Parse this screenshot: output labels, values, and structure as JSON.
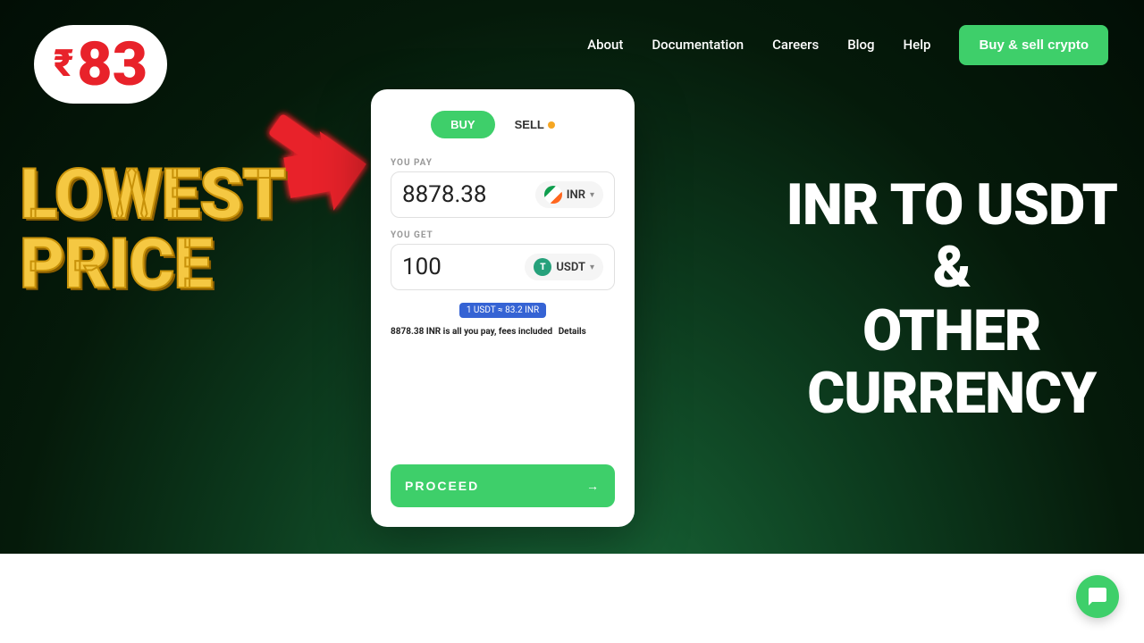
{
  "nav": {
    "links": [
      {
        "label": "About",
        "id": "about"
      },
      {
        "label": "Documentation",
        "id": "documentation"
      },
      {
        "label": "Careers",
        "id": "careers"
      },
      {
        "label": "Blog",
        "id": "blog"
      },
      {
        "label": "Help",
        "id": "help"
      }
    ],
    "cta_label": "Buy & sell crypto"
  },
  "hero": {
    "price_badge": {
      "rupee": "₹",
      "number": "83"
    },
    "lowest_price_line1": "LOWEST",
    "lowest_price_line2": "PRICE",
    "right_heading_line1": "INR TO USDT",
    "right_heading_line2": "&",
    "right_heading_line3": "OTHER",
    "right_heading_line4": "CURRENCY"
  },
  "card": {
    "buy_label": "BUY",
    "sell_label": "SELL",
    "you_pay_label": "YOU PAY",
    "you_pay_amount": "8878.38",
    "you_pay_currency": "INR",
    "you_get_label": "YOU GET",
    "you_get_amount": "100",
    "you_get_currency": "USDT",
    "rate_text": "1 USDT ≈ 83.2 INR",
    "fee_text": "8878.38 INR is all you pay, fees included",
    "details_label": "Details",
    "proceed_label": "PROCEED",
    "proceed_arrow": "→"
  },
  "chat_button": {
    "label": "Chat"
  }
}
